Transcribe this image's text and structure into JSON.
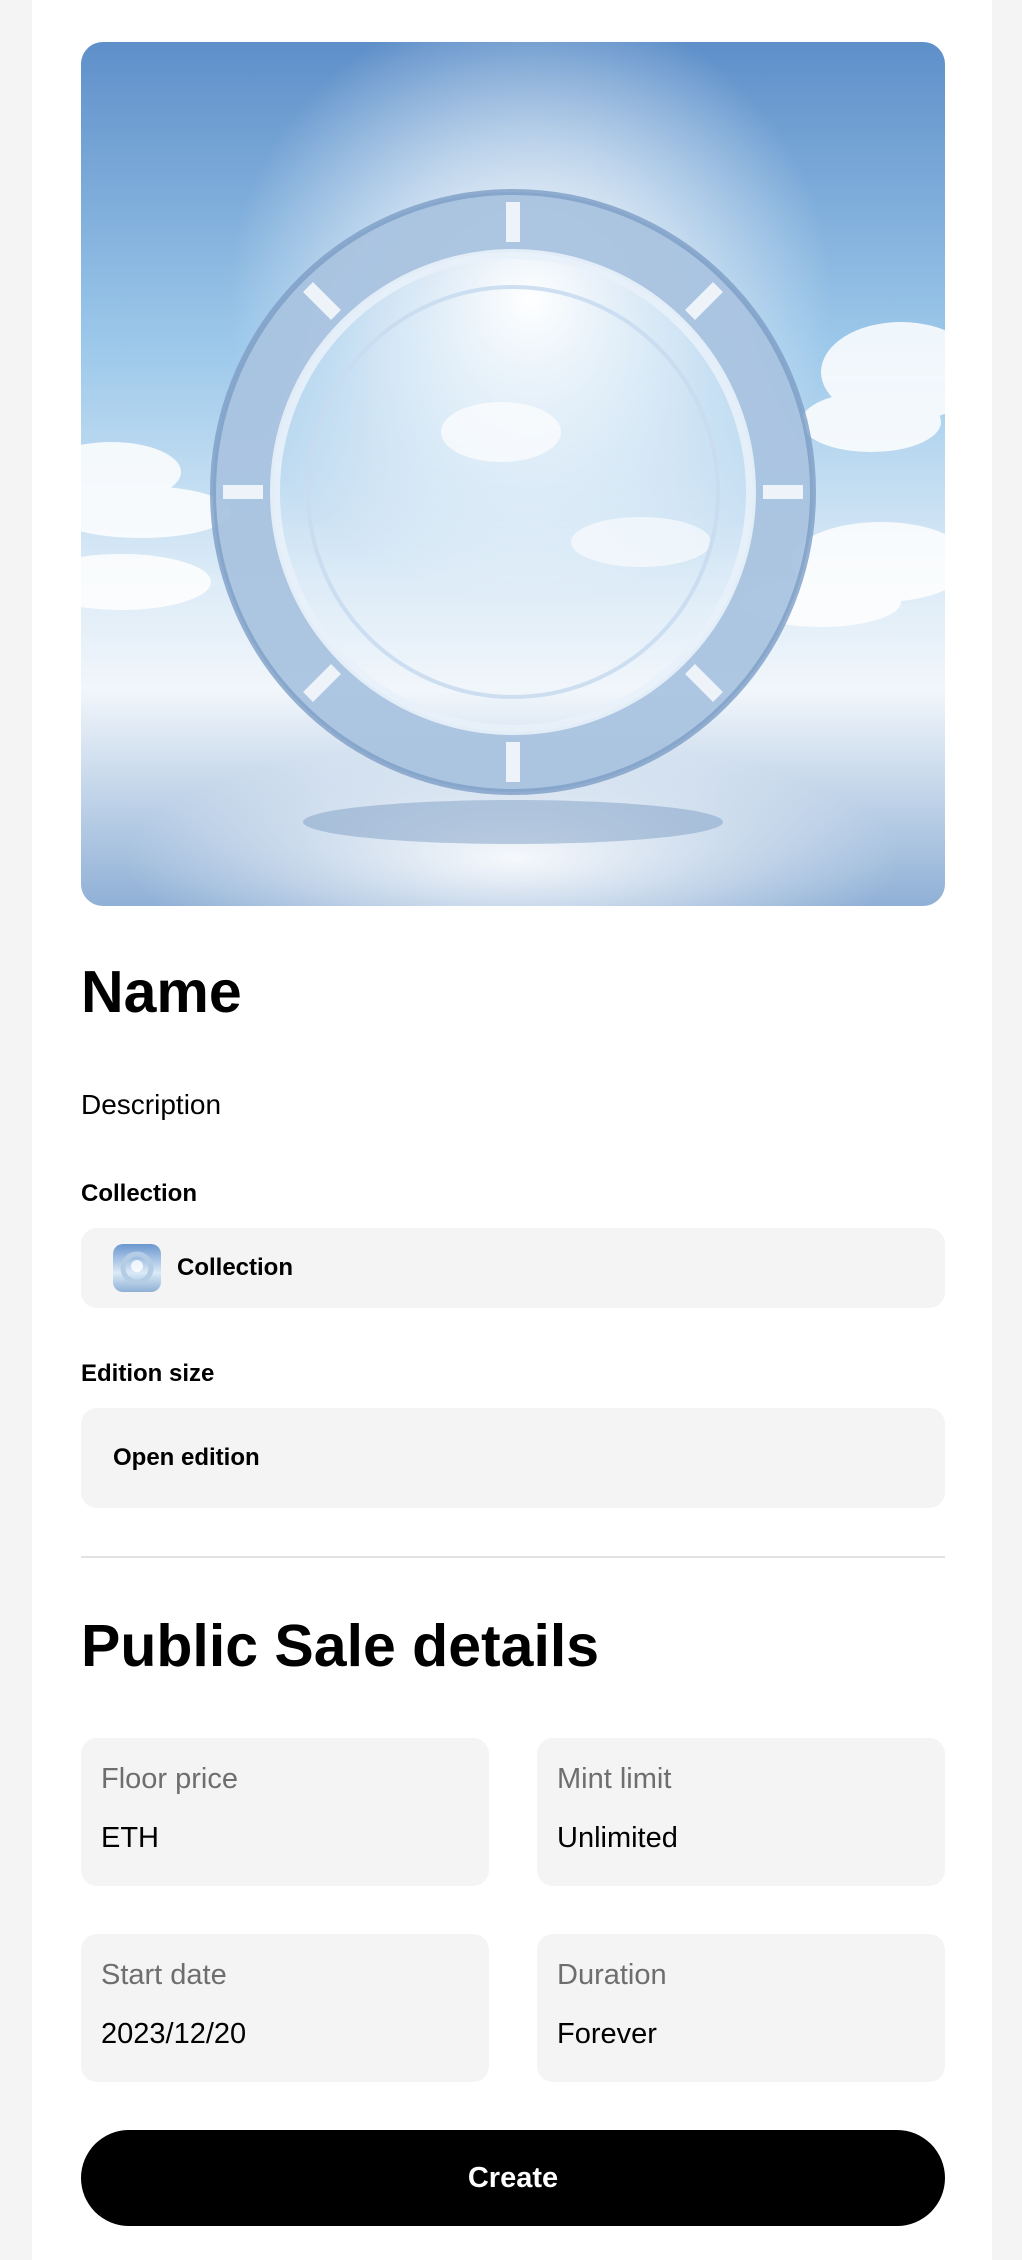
{
  "nft": {
    "image_icon": "portal-ring-artwork",
    "name": "Name",
    "description": "Description"
  },
  "collection": {
    "label": "Collection",
    "selected": "Collection",
    "thumb_icon": "collection-thumbnail"
  },
  "edition": {
    "label": "Edition size",
    "value": "Open edition"
  },
  "sale": {
    "title": "Public Sale details",
    "floor_price": {
      "label": "Floor price",
      "value": "ETH"
    },
    "mint_limit": {
      "label": "Mint limit",
      "value": "Unlimited"
    },
    "start_date": {
      "label": "Start date",
      "value": "2023/12/20"
    },
    "duration": {
      "label": "Duration",
      "value": "Forever"
    }
  },
  "actions": {
    "create_label": "Create"
  },
  "colors": {
    "page_bg": "#f4f4f4",
    "card_bg": "#ffffff",
    "field_bg": "#f4f4f4",
    "muted_text": "#6e6e6e",
    "button_bg": "#000000",
    "button_text": "#ffffff"
  }
}
